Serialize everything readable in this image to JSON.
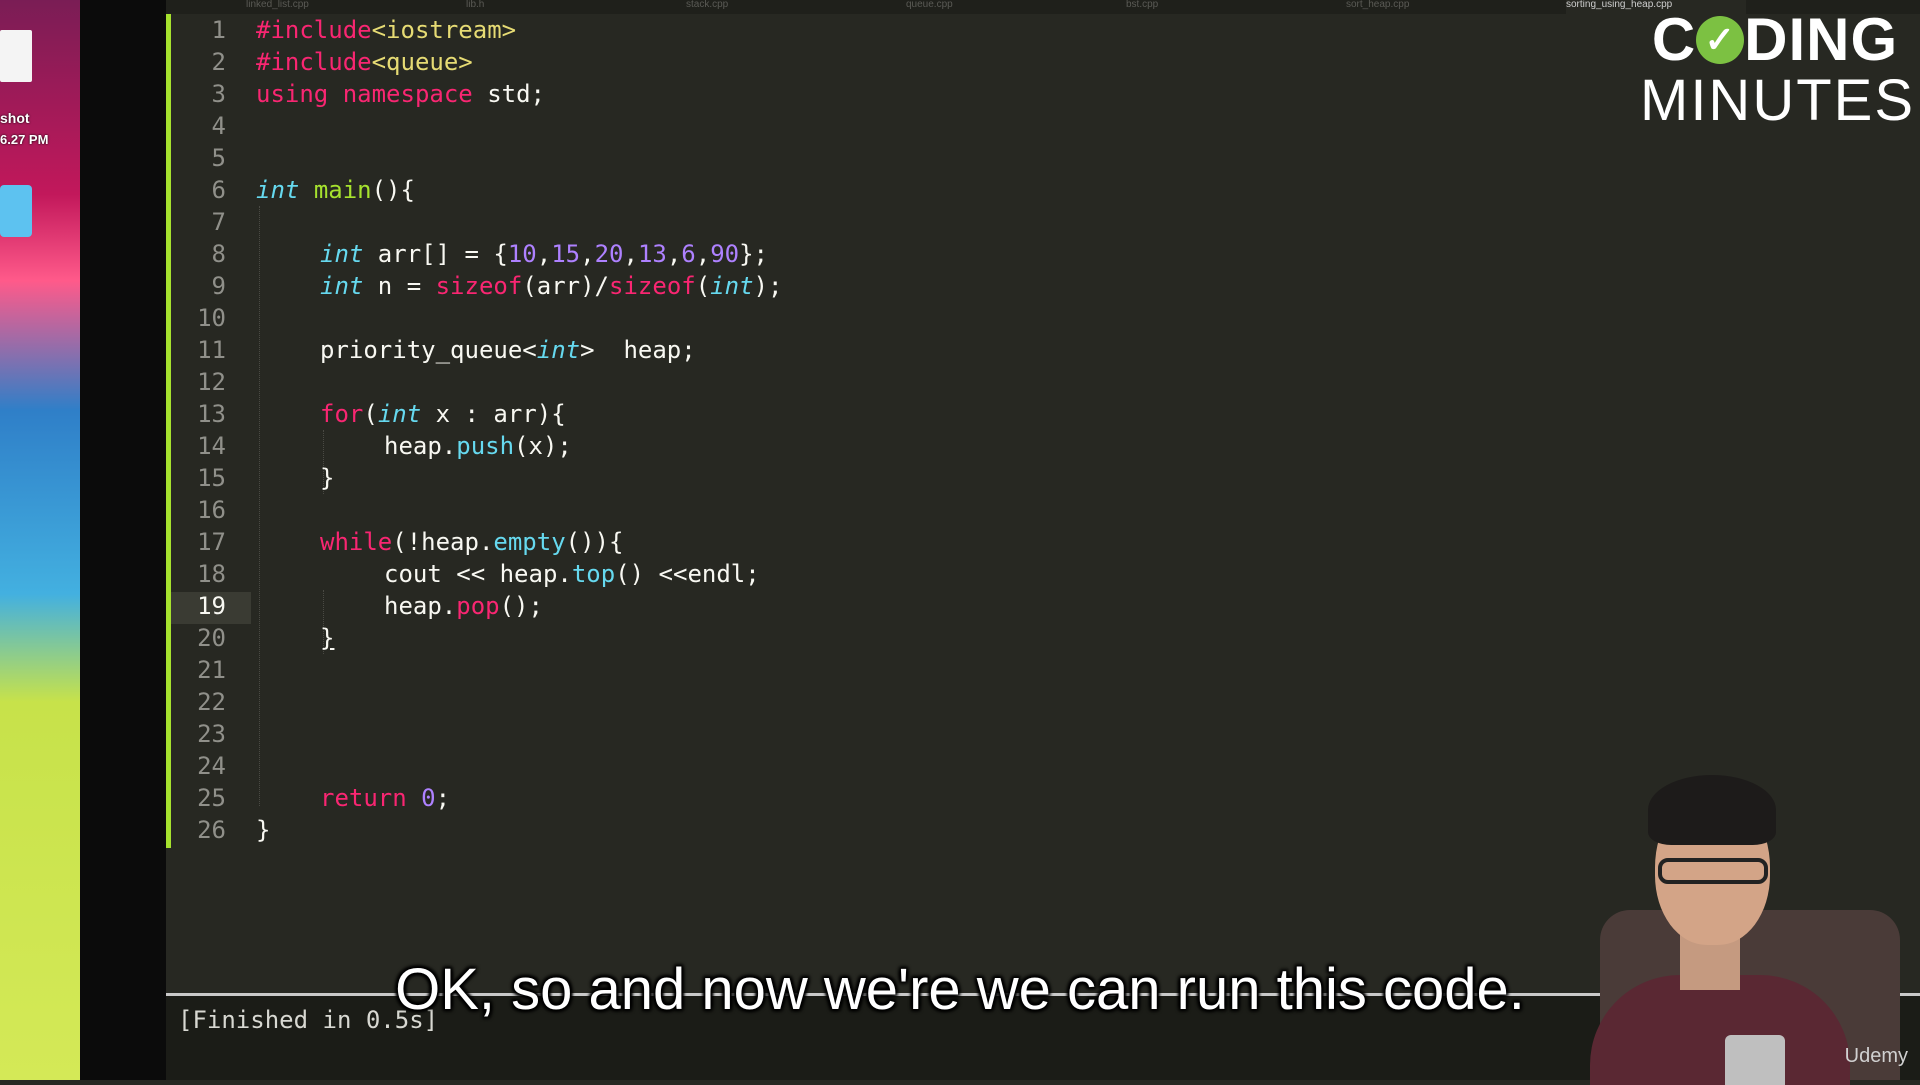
{
  "desktop": {
    "label_name": "shot",
    "label_time": "6.27 PM"
  },
  "editor": {
    "tabs": [
      "linked_list.cpp",
      "lib.h",
      "stack.cpp",
      "queue.cpp",
      "bst.cpp",
      "sort_heap.cpp",
      "sorting_using_heap.cpp"
    ],
    "active_tab_index": 6,
    "current_line": 19,
    "line_numbers": [
      "1",
      "2",
      "3",
      "4",
      "5",
      "6",
      "7",
      "8",
      "9",
      "10",
      "11",
      "12",
      "13",
      "14",
      "15",
      "16",
      "17",
      "18",
      "19",
      "20",
      "21",
      "22",
      "23",
      "24",
      "25",
      "26"
    ],
    "code": {
      "l1_a": "#include",
      "l1_b": "<iostream>",
      "l2_a": "#include",
      "l2_b": "<queue>",
      "l3_a": "using",
      "l3_b": "namespace",
      "l3_c": " std;",
      "l6_a": "int",
      "l6_b": "main",
      "l6_c": "(){",
      "l8_a": "int",
      "l8_b": " arr[] = {",
      "l8_n1": "10",
      "l8_n2": "15",
      "l8_n3": "20",
      "l8_n4": "13",
      "l8_n5": "6",
      "l8_n6": "90",
      "l8_c": "};",
      "l9_a": "int",
      "l9_b": " n = ",
      "l9_c": "sizeof",
      "l9_d": "(arr)/",
      "l9_e": "sizeof",
      "l9_f": "(",
      "l9_g": "int",
      "l9_h": ");",
      "l11_a": "priority_queue<",
      "l11_b": "int",
      "l11_c": ">  heap;",
      "l13_a": "for",
      "l13_b": "(",
      "l13_c": "int",
      "l13_d": " x : arr){",
      "l14_a": "heap.",
      "l14_b": "push",
      "l14_c": "(x);",
      "l15": "}",
      "l17_a": "while",
      "l17_b": "(!heap.",
      "l17_c": "empty",
      "l17_d": "()){",
      "l18_a": "cout << heap.",
      "l18_b": "top",
      "l18_c": "() <<endl;",
      "l19_a": "heap.",
      "l19_b": "pop",
      "l19_c": "();",
      "l20": "}",
      "l25_a": "return",
      "l25_b": "0",
      "l25_c": ";",
      "l26": "}"
    },
    "output": "[Finished in 0.5s]"
  },
  "logo": {
    "line1_a": "C",
    "line1_check": "✓",
    "line1_b": "DING",
    "line2": "MINUTES"
  },
  "caption": "OK, so and now we're we can run this code.",
  "watermark": "Udemy",
  "colors": {
    "background": "#272822",
    "keyword": "#f92672",
    "type": "#66d9ef",
    "function": "#a6e22e",
    "number": "#ae81ff",
    "string": "#e6db74",
    "gutter_change": "#a6e22e"
  }
}
